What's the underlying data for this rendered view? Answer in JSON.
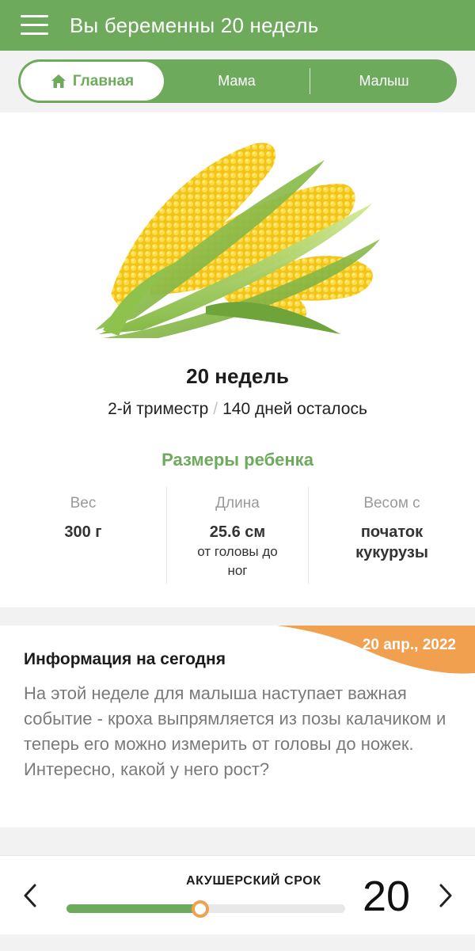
{
  "header": {
    "title": "Вы беременны 20 недель"
  },
  "tabs": [
    {
      "label": "Главная",
      "icon": "home-icon",
      "active": true
    },
    {
      "label": "Мама",
      "active": false
    },
    {
      "label": "Малыш",
      "active": false
    }
  ],
  "week_card": {
    "image": "corn-image",
    "weeks_title": "20 недель",
    "trimester": "2-й триместр",
    "separator": "/",
    "days_left": "140 дней осталось",
    "sizes_title": "Размеры ребенка",
    "stats": [
      {
        "label": "Вес",
        "value": "300 г",
        "note": ""
      },
      {
        "label": "Длина",
        "value": "25.6 см",
        "note": "от головы до ног"
      },
      {
        "label": "Весом с",
        "value": "початок кукурузы",
        "note": ""
      }
    ]
  },
  "info_card": {
    "date": "20 апр., 2022",
    "title": "Информация на сегодня",
    "text": "На этой неделе для малыша наступает важная событие - кроха выпрямляется из позы калачиком и теперь его можно измерить от головы до ножек. Интересно, какой у него рост?"
  },
  "bottom_bar": {
    "label": "АКУШЕРСКИЙ СРОК",
    "value": "20",
    "progress": 0.48
  },
  "colors": {
    "primary_green": "#6eaa5c",
    "accent_orange": "#f0a04f",
    "background": "#f2f2f2"
  }
}
